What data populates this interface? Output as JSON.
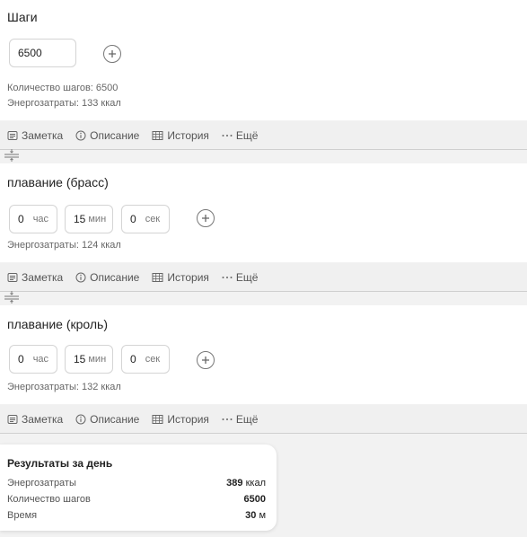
{
  "steps": {
    "title": "Шаги",
    "input_value": "6500",
    "count_line": "Количество шагов: 6500",
    "energy_line": "Энергозатраты: 133 ккал"
  },
  "toolbar": {
    "note": "Заметка",
    "description": "Описание",
    "history": "История",
    "more": "Ещё"
  },
  "breaststroke": {
    "title": "плавание (брасс)",
    "hours": "0",
    "hours_unit": "час",
    "minutes": "15",
    "minutes_unit": "мин",
    "seconds": "0",
    "seconds_unit": "сек",
    "energy_line": "Энергозатраты: 124 ккал"
  },
  "crawl": {
    "title": "плавание (кроль)",
    "hours": "0",
    "hours_unit": "час",
    "minutes": "15",
    "minutes_unit": "мин",
    "seconds": "0",
    "seconds_unit": "сек",
    "energy_line": "Энергозатраты: 132 ккал"
  },
  "results": {
    "title": "Результаты за день",
    "rows": [
      {
        "label": "Энергозатраты",
        "value": "389",
        "unit": "ккал"
      },
      {
        "label": "Количество шагов",
        "value": "6500",
        "unit": ""
      },
      {
        "label": "Время",
        "value": "30",
        "unit": "м"
      }
    ]
  },
  "icons": [
    "note-icon",
    "info-icon",
    "table-icon",
    "more-dots-icon",
    "add-circle-icon",
    "divider-handle-icon"
  ],
  "colors": {
    "background": "#f2f2f2",
    "card": "#ffffff",
    "toolbar": "#f0f0f0",
    "text": "#222222",
    "muted": "#666666"
  }
}
